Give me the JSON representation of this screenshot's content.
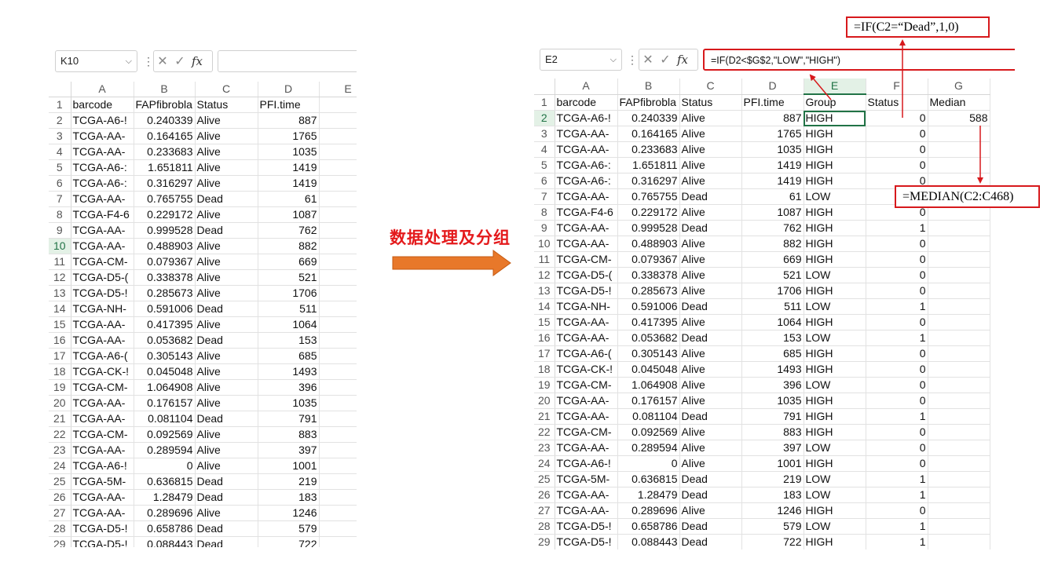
{
  "left": {
    "name_box": "K10",
    "formula": "",
    "columns": [
      "A",
      "B",
      "C",
      "D",
      "E"
    ],
    "header_row": [
      "barcode",
      "FAPfibrobla",
      "Status",
      "PFI.time",
      ""
    ],
    "rows": [
      [
        "TCGA-A6-!",
        "0.240339",
        "Alive",
        "887"
      ],
      [
        "TCGA-AA-",
        "0.164165",
        "Alive",
        "1765"
      ],
      [
        "TCGA-AA-",
        "0.233683",
        "Alive",
        "1035"
      ],
      [
        "TCGA-A6-:",
        "1.651811",
        "Alive",
        "1419"
      ],
      [
        "TCGA-A6-:",
        "0.316297",
        "Alive",
        "1419"
      ],
      [
        "TCGA-AA-",
        "0.765755",
        "Dead",
        "61"
      ],
      [
        "TCGA-F4-6",
        "0.229172",
        "Alive",
        "1087"
      ],
      [
        "TCGA-AA-",
        "0.999528",
        "Dead",
        "762"
      ],
      [
        "TCGA-AA-",
        "0.488903",
        "Alive",
        "882"
      ],
      [
        "TCGA-CM-",
        "0.079367",
        "Alive",
        "669"
      ],
      [
        "TCGA-D5-(",
        "0.338378",
        "Alive",
        "521"
      ],
      [
        "TCGA-D5-!",
        "0.285673",
        "Alive",
        "1706"
      ],
      [
        "TCGA-NH-",
        "0.591006",
        "Dead",
        "511"
      ],
      [
        "TCGA-AA-",
        "0.417395",
        "Alive",
        "1064"
      ],
      [
        "TCGA-AA-",
        "0.053682",
        "Dead",
        "153"
      ],
      [
        "TCGA-A6-(",
        "0.305143",
        "Alive",
        "685"
      ],
      [
        "TCGA-CK-!",
        "0.045048",
        "Alive",
        "1493"
      ],
      [
        "TCGA-CM-",
        "1.064908",
        "Alive",
        "396"
      ],
      [
        "TCGA-AA-",
        "0.176157",
        "Alive",
        "1035"
      ],
      [
        "TCGA-AA-",
        "0.081104",
        "Dead",
        "791"
      ],
      [
        "TCGA-CM-",
        "0.092569",
        "Alive",
        "883"
      ],
      [
        "TCGA-AA-",
        "0.289594",
        "Alive",
        "397"
      ],
      [
        "TCGA-A6-!",
        "0",
        "Alive",
        "1001"
      ],
      [
        "TCGA-5M-",
        "0.636815",
        "Dead",
        "219"
      ],
      [
        "TCGA-AA-",
        "1.28479",
        "Dead",
        "183"
      ],
      [
        "TCGA-AA-",
        "0.289696",
        "Alive",
        "1246"
      ],
      [
        "TCGA-D5-!",
        "0.658786",
        "Dead",
        "579"
      ],
      [
        "TCGA-D5-!",
        "0.088443",
        "Dead",
        "722"
      ]
    ]
  },
  "right": {
    "name_box": "E2",
    "formula": "=IF(D2<$G$2,\"LOW\",\"HIGH\")",
    "columns": [
      "A",
      "B",
      "C",
      "D",
      "E",
      "F",
      "G"
    ],
    "header_row": [
      "barcode",
      "FAPfibrobla",
      "Status",
      "PFI.time",
      "Group",
      "Status",
      "Median"
    ],
    "median_value": "588",
    "rows": [
      [
        "TCGA-A6-!",
        "0.240339",
        "Alive",
        "887",
        "HIGH",
        "0"
      ],
      [
        "TCGA-AA-",
        "0.164165",
        "Alive",
        "1765",
        "HIGH",
        "0"
      ],
      [
        "TCGA-AA-",
        "0.233683",
        "Alive",
        "1035",
        "HIGH",
        "0"
      ],
      [
        "TCGA-A6-:",
        "1.651811",
        "Alive",
        "1419",
        "HIGH",
        "0"
      ],
      [
        "TCGA-A6-:",
        "0.316297",
        "Alive",
        "1419",
        "HIGH",
        "0"
      ],
      [
        "TCGA-AA-",
        "0.765755",
        "Dead",
        "61",
        "LOW",
        "1"
      ],
      [
        "TCGA-F4-6",
        "0.229172",
        "Alive",
        "1087",
        "HIGH",
        "0"
      ],
      [
        "TCGA-AA-",
        "0.999528",
        "Dead",
        "762",
        "HIGH",
        "1"
      ],
      [
        "TCGA-AA-",
        "0.488903",
        "Alive",
        "882",
        "HIGH",
        "0"
      ],
      [
        "TCGA-CM-",
        "0.079367",
        "Alive",
        "669",
        "HIGH",
        "0"
      ],
      [
        "TCGA-D5-(",
        "0.338378",
        "Alive",
        "521",
        "LOW",
        "0"
      ],
      [
        "TCGA-D5-!",
        "0.285673",
        "Alive",
        "1706",
        "HIGH",
        "0"
      ],
      [
        "TCGA-NH-",
        "0.591006",
        "Dead",
        "511",
        "LOW",
        "1"
      ],
      [
        "TCGA-AA-",
        "0.417395",
        "Alive",
        "1064",
        "HIGH",
        "0"
      ],
      [
        "TCGA-AA-",
        "0.053682",
        "Dead",
        "153",
        "LOW",
        "1"
      ],
      [
        "TCGA-A6-(",
        "0.305143",
        "Alive",
        "685",
        "HIGH",
        "0"
      ],
      [
        "TCGA-CK-!",
        "0.045048",
        "Alive",
        "1493",
        "HIGH",
        "0"
      ],
      [
        "TCGA-CM-",
        "1.064908",
        "Alive",
        "396",
        "LOW",
        "0"
      ],
      [
        "TCGA-AA-",
        "0.176157",
        "Alive",
        "1035",
        "HIGH",
        "0"
      ],
      [
        "TCGA-AA-",
        "0.081104",
        "Dead",
        "791",
        "HIGH",
        "1"
      ],
      [
        "TCGA-CM-",
        "0.092569",
        "Alive",
        "883",
        "HIGH",
        "0"
      ],
      [
        "TCGA-AA-",
        "0.289594",
        "Alive",
        "397",
        "LOW",
        "0"
      ],
      [
        "TCGA-A6-!",
        "0",
        "Alive",
        "1001",
        "HIGH",
        "0"
      ],
      [
        "TCGA-5M-",
        "0.636815",
        "Dead",
        "219",
        "LOW",
        "1"
      ],
      [
        "TCGA-AA-",
        "1.28479",
        "Dead",
        "183",
        "LOW",
        "1"
      ],
      [
        "TCGA-AA-",
        "0.289696",
        "Alive",
        "1246",
        "HIGH",
        "0"
      ],
      [
        "TCGA-D5-!",
        "0.658786",
        "Dead",
        "579",
        "LOW",
        "1"
      ],
      [
        "TCGA-D5-!",
        "0.088443",
        "Dead",
        "722",
        "HIGH",
        "1"
      ]
    ]
  },
  "center_label": "数据处理及分组",
  "annotations": {
    "if_dead": "=IF(C2=“Dead”,1,0)",
    "median": "=MEDIAN(C2:C468)"
  },
  "icons": {
    "cancel": "✕",
    "confirm": "✓",
    "fx": "fx",
    "more": "⋮",
    "chevron": "⌵"
  },
  "colors": {
    "annotation_red": "#d7191c",
    "arrow_orange": "#e8782a",
    "excel_green": "#217346"
  }
}
